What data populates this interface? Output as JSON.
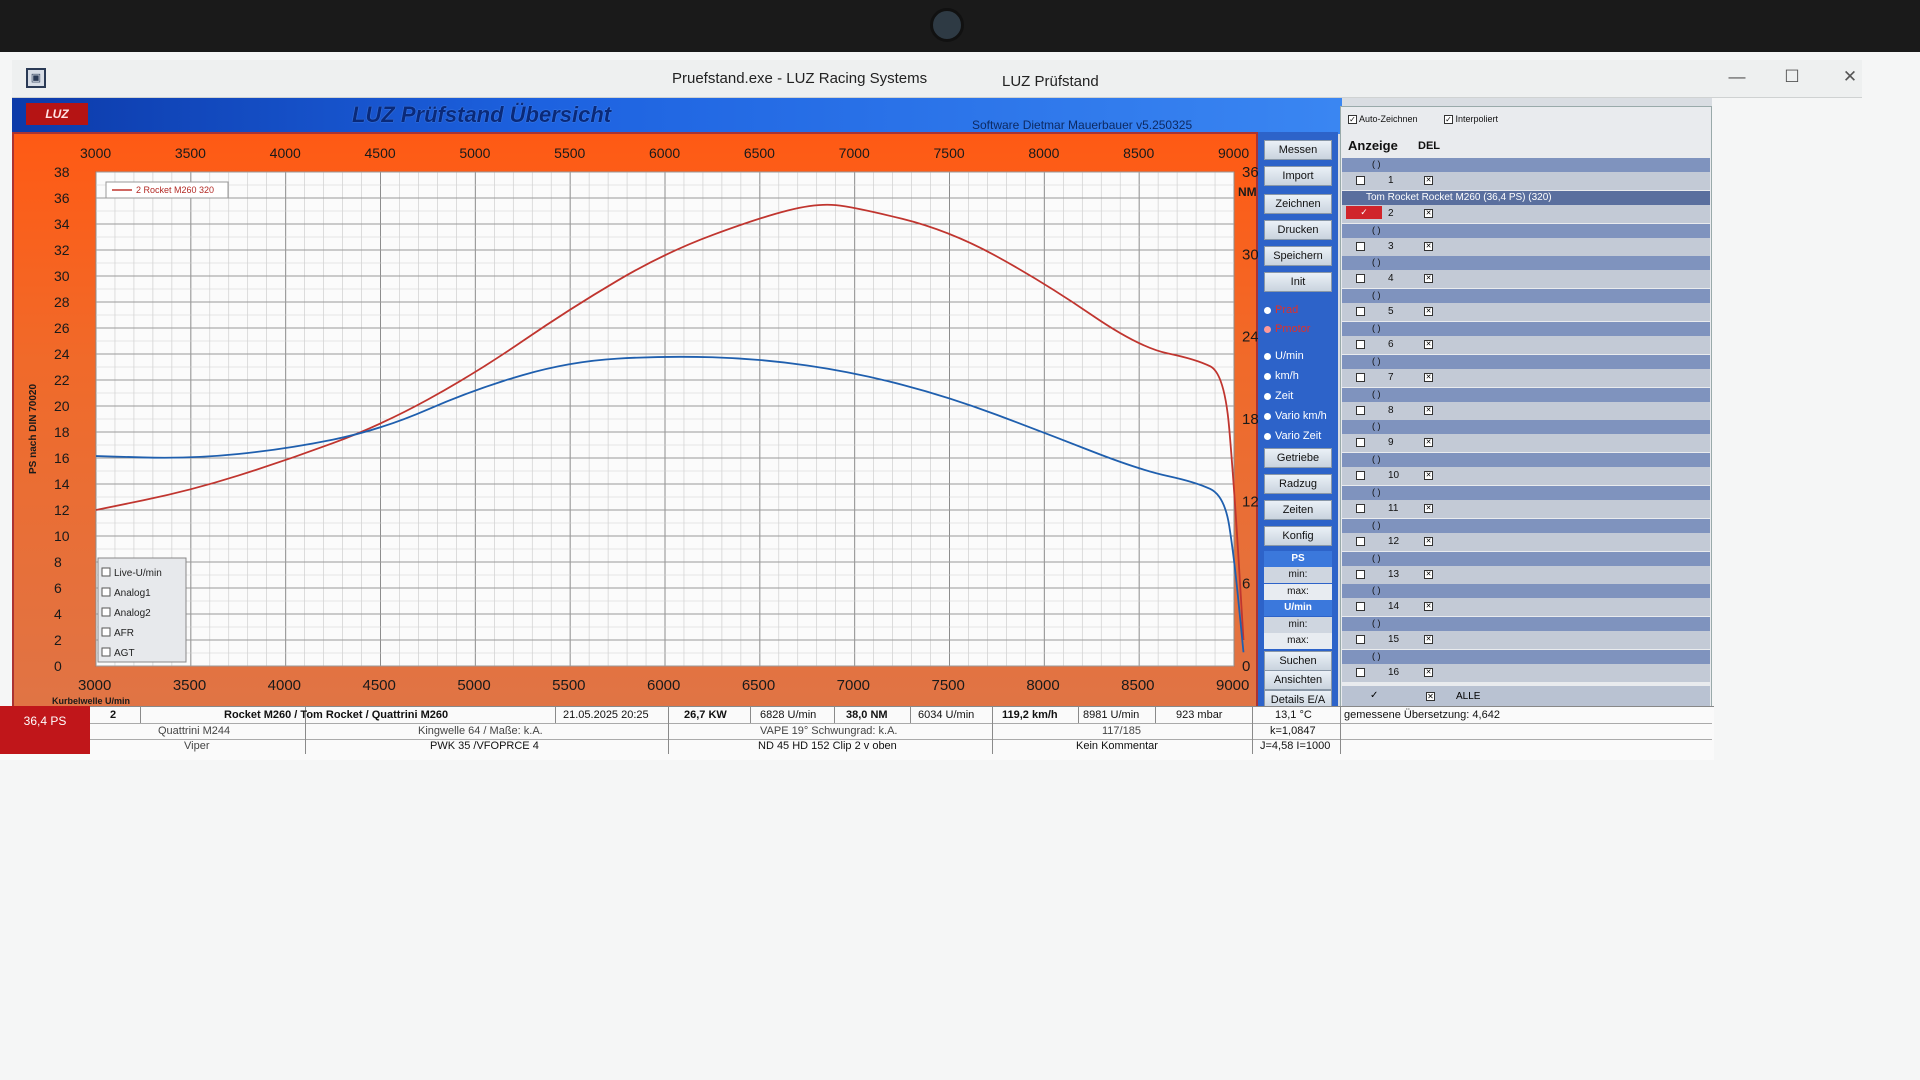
{
  "window": {
    "title_left": "Pruefstand.exe -   LUZ Racing Systems",
    "title_right": "LUZ Prüfstand",
    "minimize": "—",
    "maximize": "☐",
    "close": "✕"
  },
  "banner": {
    "logo": "LUZ",
    "title": "LUZ Prüfstand  Übersicht",
    "software": "Software Dietmar Mauerbauer v5.250325"
  },
  "chart_data": {
    "type": "line",
    "x_top_ticks": [
      "3000",
      "3500",
      "4000",
      "4500",
      "5000",
      "5500",
      "6000",
      "6500",
      "7000",
      "7500",
      "8000",
      "8500",
      "9000"
    ],
    "x_bottom_ticks": [
      "3000",
      "3500",
      "4000",
      "4500",
      "5000",
      "5500",
      "6000",
      "6500",
      "7000",
      "7500",
      "8000",
      "8500",
      "9000"
    ],
    "xlabel": "Kurbelwelle U/min",
    "y_left_ticks": [
      "38",
      "36",
      "34",
      "32",
      "30",
      "28",
      "26",
      "24",
      "22",
      "20",
      "18",
      "16",
      "14",
      "12",
      "10",
      "8",
      "6",
      "4",
      "2",
      "0"
    ],
    "ylabel_left": "PS nach DIN 70020",
    "y_right_label": "NM",
    "y_right_ticks": [
      "36",
      "30",
      "24",
      "18",
      "12",
      "6",
      "0"
    ],
    "xlim": [
      3000,
      9000
    ],
    "ylim_left": [
      0,
      38
    ],
    "ylim_right": [
      0,
      36
    ],
    "legend_entry": "2  Rocket M260 320",
    "channel_list": [
      "Live-U/min",
      "Analog1",
      "Analog2",
      "AFR",
      "AGT"
    ],
    "series": [
      {
        "name": "Rocket M260 320",
        "axis": "left",
        "color": "#c0352f",
        "x": [
          3000,
          3500,
          4000,
          4500,
          5000,
          5500,
          6000,
          6500,
          6800,
          7000,
          7500,
          8000,
          8500,
          8800,
          8950,
          9000,
          9050
        ],
        "y": [
          12,
          13.5,
          15.8,
          18.5,
          22.5,
          27.5,
          31.8,
          34.5,
          35.6,
          35.3,
          33.5,
          29.5,
          24.5,
          23.6,
          22.5,
          14,
          2
        ]
      },
      {
        "name": "Torque",
        "axis": "right",
        "color": "#1f5fae",
        "x": [
          3000,
          3500,
          4000,
          4500,
          5000,
          5500,
          6000,
          6500,
          7000,
          7500,
          8000,
          8500,
          8800,
          8950,
          9000,
          9050
        ],
        "y": [
          15.3,
          15.1,
          15.8,
          17.2,
          20.2,
          22.2,
          22.6,
          22.4,
          21.4,
          19.6,
          17.0,
          14.3,
          13.4,
          12.4,
          8,
          1
        ]
      }
    ]
  },
  "side_buttons": {
    "messen": "Messen",
    "import": "Import",
    "zeichnen": "Zeichnen",
    "drucken": "Drucken",
    "speichern": "Speichern",
    "init": "Init",
    "prad": "Prad",
    "pmotor": "Pmotor",
    "umin": "U/min",
    "kmh": "km/h",
    "zeit": "Zeit",
    "vario_kmh": "Vario km/h",
    "vario_zeit": "Vario Zeit",
    "getriebe": "Getriebe",
    "radzug": "Radzug",
    "zeiten": "Zeiten",
    "konfig": "Konfig",
    "ps_label": "PS",
    "ps_min": "min:",
    "ps_max": "max:",
    "umin_label": "U/min",
    "umin_min": "min:",
    "umin_max": "max:",
    "suchen": "Suchen",
    "ansichten": "Ansichten",
    "details": "Details E/A"
  },
  "right_panel": {
    "auto_zeichnen": "Auto-Zeichnen",
    "interpoliert": "Interpoliert",
    "anzeige": "Anzeige",
    "del": "DEL",
    "slots": [
      {
        "num": "1",
        "label": "( )"
      },
      {
        "num": "2",
        "label": "Tom Rocket  Rocket M260 (36,4 PS) (320)"
      },
      {
        "num": "3",
        "label": "( )"
      },
      {
        "num": "4",
        "label": "( )"
      },
      {
        "num": "5",
        "label": "( )"
      },
      {
        "num": "6",
        "label": "( )"
      },
      {
        "num": "7",
        "label": "( )"
      },
      {
        "num": "8",
        "label": "( )"
      },
      {
        "num": "9",
        "label": "( )"
      },
      {
        "num": "10",
        "label": "( )"
      },
      {
        "num": "11",
        "label": "( )"
      },
      {
        "num": "12",
        "label": "( )"
      },
      {
        "num": "13",
        "label": "( )"
      },
      {
        "num": "14",
        "label": "( )"
      },
      {
        "num": "15",
        "label": "( )"
      },
      {
        "num": "16",
        "label": "( )"
      }
    ],
    "alle_check": "✓",
    "alle": "ALLE",
    "uebersetzung": "gemessene Übersetzung: 4,642"
  },
  "info": {
    "ps": "36,4  PS",
    "run_no": "2",
    "engine": "Rocket M260 / Tom Rocket  / Quattrini M260",
    "date": "21.05.2025 20:25",
    "kw": "26,7  KW",
    "kw_rpm": "6828  U/min",
    "nm": "38,0  NM",
    "nm_rpm": "6034  U/min",
    "speed": "119,2 km/h",
    "max_rpm": "8981  U/min",
    "pressure": "923  mbar",
    "temp": "13,1 °C",
    "row2_a": "Quattrini M244",
    "row2_b": "Kingwelle 64 / Maße: k.A.",
    "row2_c": "VAPE 19° Schwungrad: k.A.",
    "row2_d": "117/185",
    "row2_e": "k=1,0847",
    "row3_a": "Viper",
    "row3_b": "PWK 35 /VFOPRCE 4",
    "row3_c": "ND 45 HD 152 Clip 2 v oben",
    "row3_d": "Kein Kommentar",
    "row3_e": "J=4,58 I=1000"
  }
}
